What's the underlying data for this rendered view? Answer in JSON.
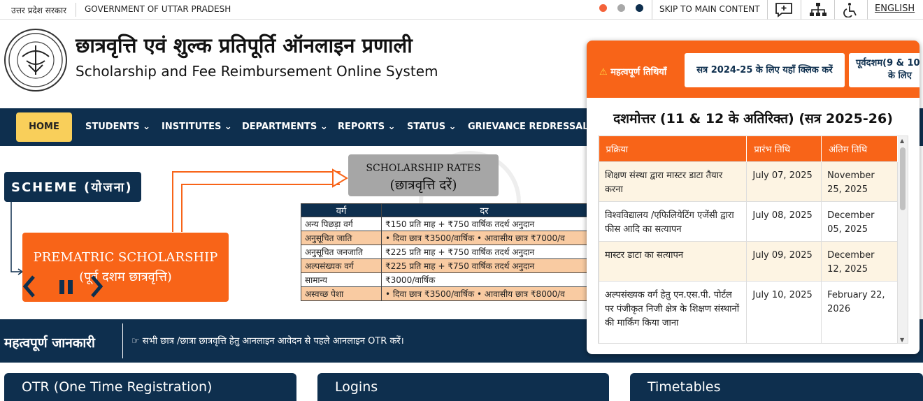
{
  "topbar": {
    "state_hi": "उत्तर प्रदेश सरकार",
    "gov": "GOVERNMENT OF UTTAR PRADESH",
    "theme_colors": [
      "#f4623a",
      "#a8a8a8",
      "#0e2f4e"
    ],
    "skip": "SKIP TO MAIN CONTENT",
    "icons": [
      "chat-icon",
      "sitemap-icon",
      "accessibility-icon"
    ],
    "language": "ENGLISH"
  },
  "header": {
    "title_hi": "छात्रवृत्ति एवं शुल्क प्रतिपूर्ति ऑनलाइन प्रणाली",
    "title_en": "Scholarship and Fee Reimbursement Online System"
  },
  "nav": {
    "home": "HOME",
    "items": [
      "STUDENTS",
      "INSTITUTES",
      "DEPARTMENTS",
      "REPORTS",
      "STATUS",
      "GRIEVANCE REDRESSAL S"
    ]
  },
  "banner": {
    "scheme": "SCHEME (योजना)",
    "rates_en": "SCHOLARSHIP RATES",
    "rates_hi": "(छात्रवृत्ति दरें)",
    "prematric_en": "PREMATRIC SCHOLARSHIP",
    "prematric_hi": "(पूर्व दशम छात्रवृत्ति)",
    "table_headers": [
      "वर्ग",
      "दर"
    ],
    "rows": [
      [
        "अन्य पिछड़ा वर्ग",
        "₹150 प्रति माह + ₹750 वार्षिक तदर्थ अनुदान"
      ],
      [
        "अनुसूचित जाति",
        "• दिवा छात्र ₹3500/वार्षिक • आवासीय छात्र ₹7000/व"
      ],
      [
        "अनुसूचित जनजाति",
        "₹225 प्रति माह + ₹750 वार्षिक तदर्थ अनुदान"
      ],
      [
        "अल्पसंख्यक वर्ग",
        "₹225 प्रति माह + ₹750 वार्षिक तदर्थ अनुदान"
      ],
      [
        "सामान्य",
        "₹3000/वार्षिक"
      ],
      [
        "अस्वच्छ पेशा",
        "• दिवा छात्र ₹3500/वार्षिक • आवासीय छात्र ₹8000/व"
      ]
    ]
  },
  "info": {
    "label": "महत्वपूर्ण जानकारी",
    "message": "सभी छात्र /छात्रा छात्रवृत्ति हेतु आनलाइन आवेदन से पहले आनलाइन OTR करें।"
  },
  "cards": [
    "OTR (One Time Registration)",
    "Logins",
    "Timetables"
  ],
  "popup": {
    "important": "महत्वपूर्ण तिथियाँ",
    "btn_session": "सत्र 2024-25 के लिए यहाँ क्लिक करें",
    "btn_pre_l1": "पूर्वदशम(9 & 10",
    "btn_pre_l2": "के लिए",
    "title": "दशमोत्तर (11 & 12 के अतिरिक्त) (सत्र 2025-26)",
    "headers": [
      "प्रक्रिया",
      "प्रारंभ तिथि",
      "अंतिम तिथि"
    ],
    "rows": [
      [
        "शिक्षण संस्था द्वारा मास्टर डाटा तैयार करना",
        "July 07, 2025",
        "November 25, 2025"
      ],
      [
        "विश्वविद्यालय /एफिलियेटिंग एजेंसी द्वारा फीस आदि का सत्यापन",
        "July 08, 2025",
        "December 05, 2025"
      ],
      [
        "मास्टर डाटा का सत्यापन",
        "July 09, 2025",
        "December 12, 2025"
      ],
      [
        "अल्पसंख्यक वर्ग हेतु एन.एस.पी. पोर्टल पर पंजीकृत निजी क्षेत्र के शिक्षण संस्थानों की मार्किंग किया जाना",
        "July 10, 2025",
        "February 22, 2026"
      ]
    ]
  }
}
